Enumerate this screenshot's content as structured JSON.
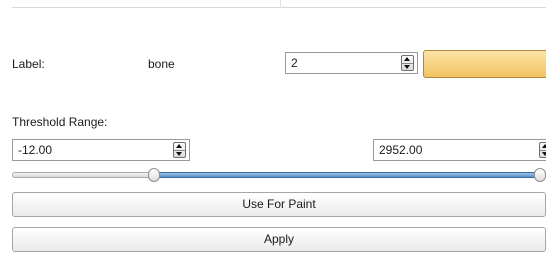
{
  "label_row": {
    "label_text": "Label:",
    "label_name": "bone",
    "label_value": "2",
    "color_swatch": "#f5cb6e"
  },
  "threshold": {
    "title": "Threshold Range:",
    "min_value": "-12.00",
    "max_value": "2952.00",
    "slider_lower_fraction": 0.26,
    "slider_upper_fraction": 1.0
  },
  "buttons": {
    "use_for_paint": "Use For Paint",
    "apply": "Apply"
  }
}
